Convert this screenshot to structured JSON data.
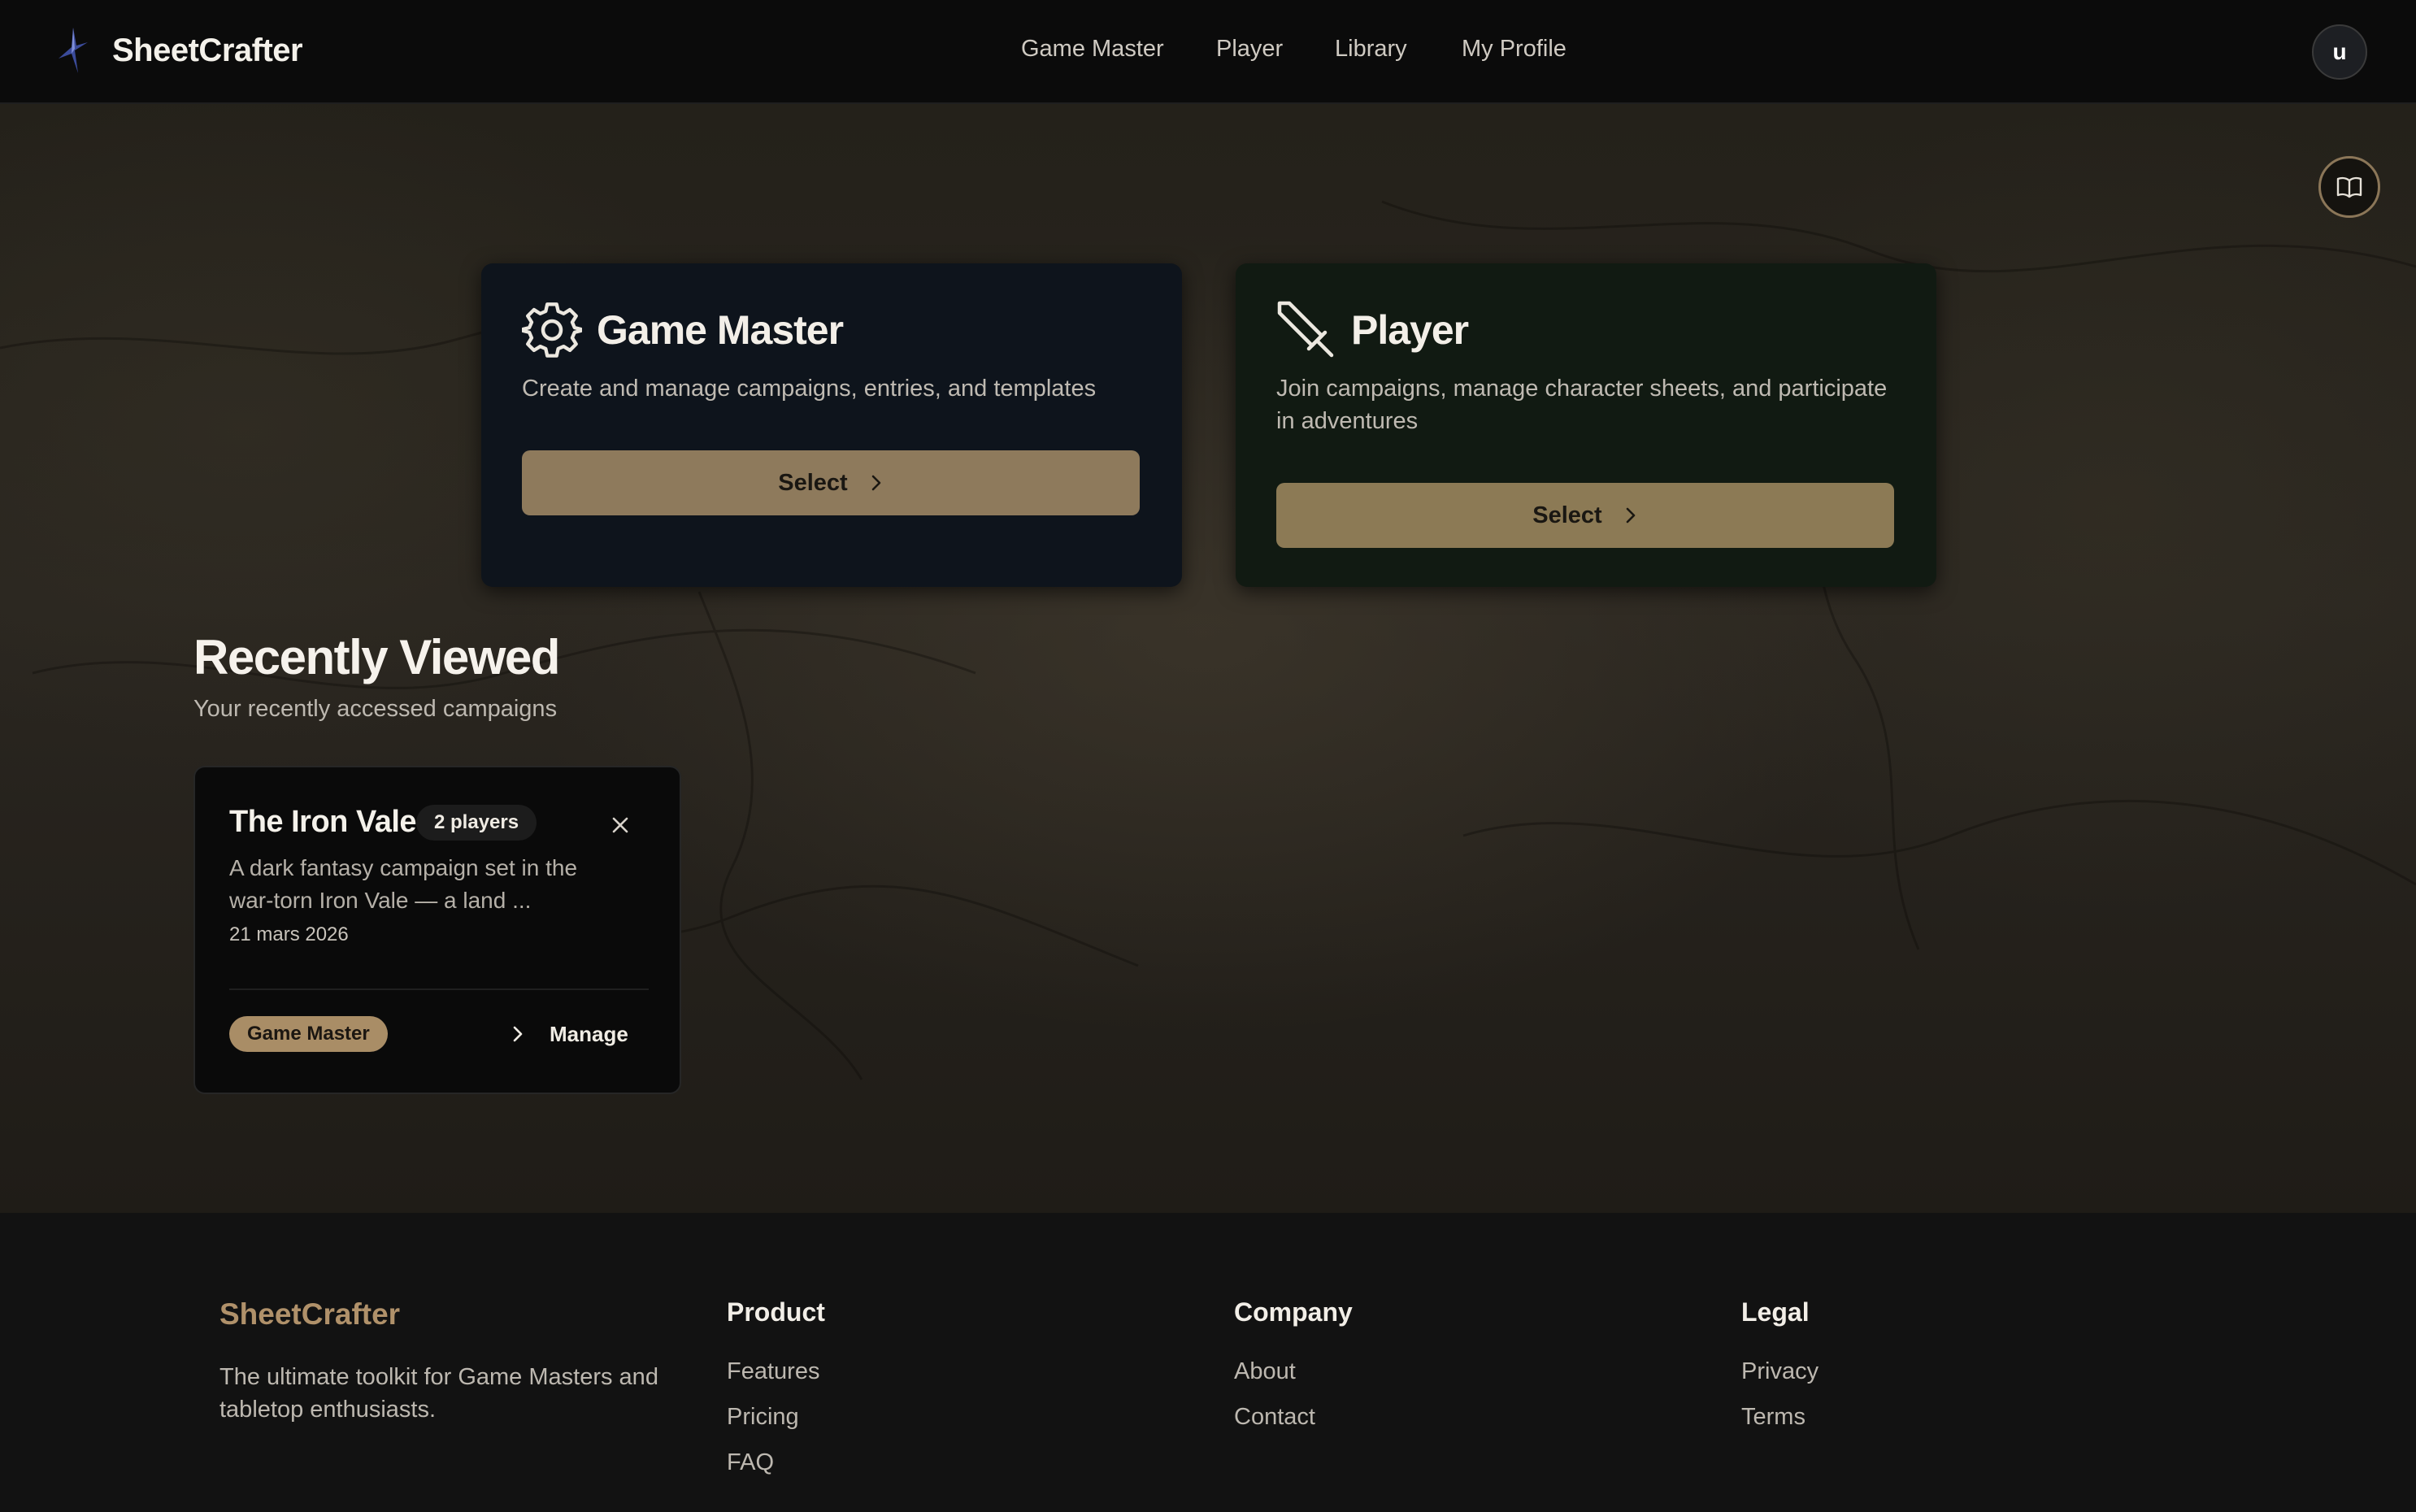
{
  "app": {
    "name": "SheetCrafter",
    "avatar_letter": "u"
  },
  "nav": {
    "items": [
      "Game Master",
      "Player",
      "Library",
      "My Profile"
    ]
  },
  "roles": [
    {
      "title": "Game Master",
      "description": "Create and manage campaigns, entries, and templates",
      "button": "Select",
      "icon": "gear-icon"
    },
    {
      "title": "Player",
      "description": "Join campaigns, manage character sheets, and participate in adventures",
      "button": "Select",
      "icon": "sword-icon"
    }
  ],
  "recent": {
    "title": "Recently Viewed",
    "subtitle": "Your recently accessed campaigns",
    "campaigns": [
      {
        "name": "The Iron Vale",
        "players": "2 players",
        "description": "A dark fantasy campaign set in the war-torn Iron Vale — a land ...",
        "date": "21 mars 2026",
        "role": "Game Master",
        "action": "Manage"
      }
    ]
  },
  "footer": {
    "brand": "SheetCrafter",
    "tagline": "The ultimate toolkit for Game Masters and tabletop enthusiasts.",
    "columns": [
      {
        "title": "Product",
        "links": [
          "Features",
          "Pricing",
          "FAQ"
        ]
      },
      {
        "title": "Company",
        "links": [
          "About",
          "Contact"
        ]
      },
      {
        "title": "Legal",
        "links": [
          "Privacy",
          "Terms"
        ]
      }
    ]
  },
  "colors": {
    "accent": "#8e7a5c",
    "brand_footer": "#b0916a",
    "header_bg": "#0b0b0b",
    "gm_card": "#0e141c",
    "player_card": "#111a12"
  }
}
